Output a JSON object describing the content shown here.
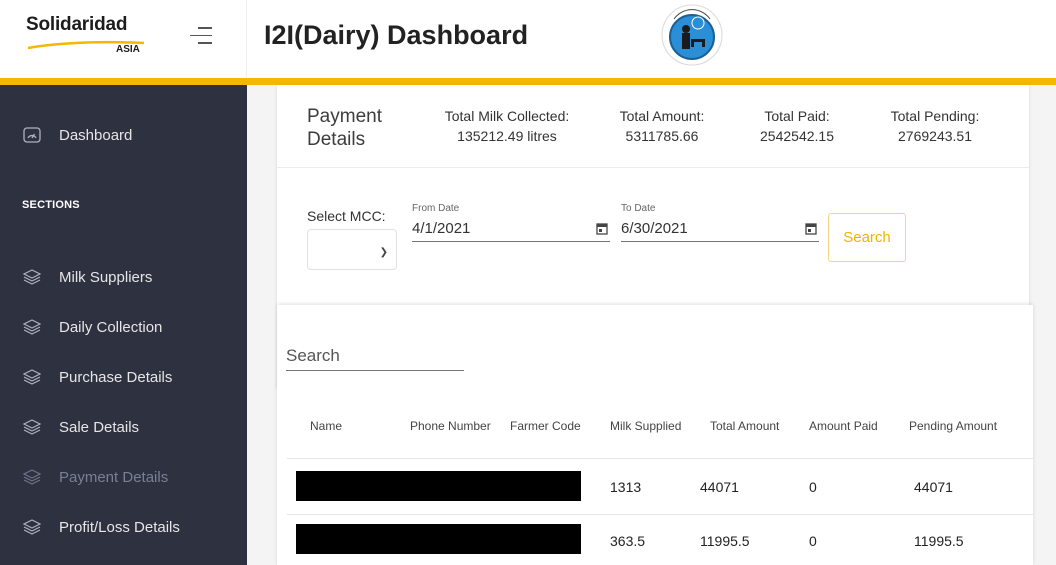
{
  "header": {
    "brand_name": "Solidaridad",
    "brand_sub": "ASIA",
    "page_title": "I2I(Dairy) Dashboard",
    "logo_icon": "i2i-dairy-logo-icon",
    "accent_color": "#f5b800"
  },
  "sidebar": {
    "dashboard_label": "Dashboard",
    "section_label": "SECTIONS",
    "items": [
      {
        "label": "Milk Suppliers"
      },
      {
        "label": "Daily Collection"
      },
      {
        "label": "Purchase Details"
      },
      {
        "label": "Sale Details"
      },
      {
        "label": "Payment Details",
        "active": true
      },
      {
        "label": "Profit/Loss Details"
      }
    ]
  },
  "summary": {
    "title": "Payment Details",
    "stats": [
      {
        "label": "Total Milk Collected:",
        "value": "135212.49 litres"
      },
      {
        "label": "Total Amount:",
        "value": "5311785.66"
      },
      {
        "label": "Total Paid:",
        "value": "2542542.15"
      },
      {
        "label": "Total Pending:",
        "value": "2769243.51"
      }
    ]
  },
  "filters": {
    "mcc_label": "Select MCC:",
    "mcc_value": "",
    "from_label": "From Date",
    "from_value": "4/1/2021",
    "to_label": "To Date",
    "to_value": "6/30/2021",
    "search_button": "Search"
  },
  "table": {
    "search_placeholder": "Search",
    "columns": [
      "Name",
      "Phone Number",
      "Farmer Code",
      "Milk Supplied",
      "Total Amount",
      "Amount Paid",
      "Pending Amount"
    ],
    "rows": [
      {
        "milk": "1313",
        "total": "44071",
        "paid": "0",
        "pending": "44071"
      },
      {
        "milk": "363.5",
        "total": "11995.5",
        "paid": "0",
        "pending": "11995.5"
      }
    ]
  }
}
